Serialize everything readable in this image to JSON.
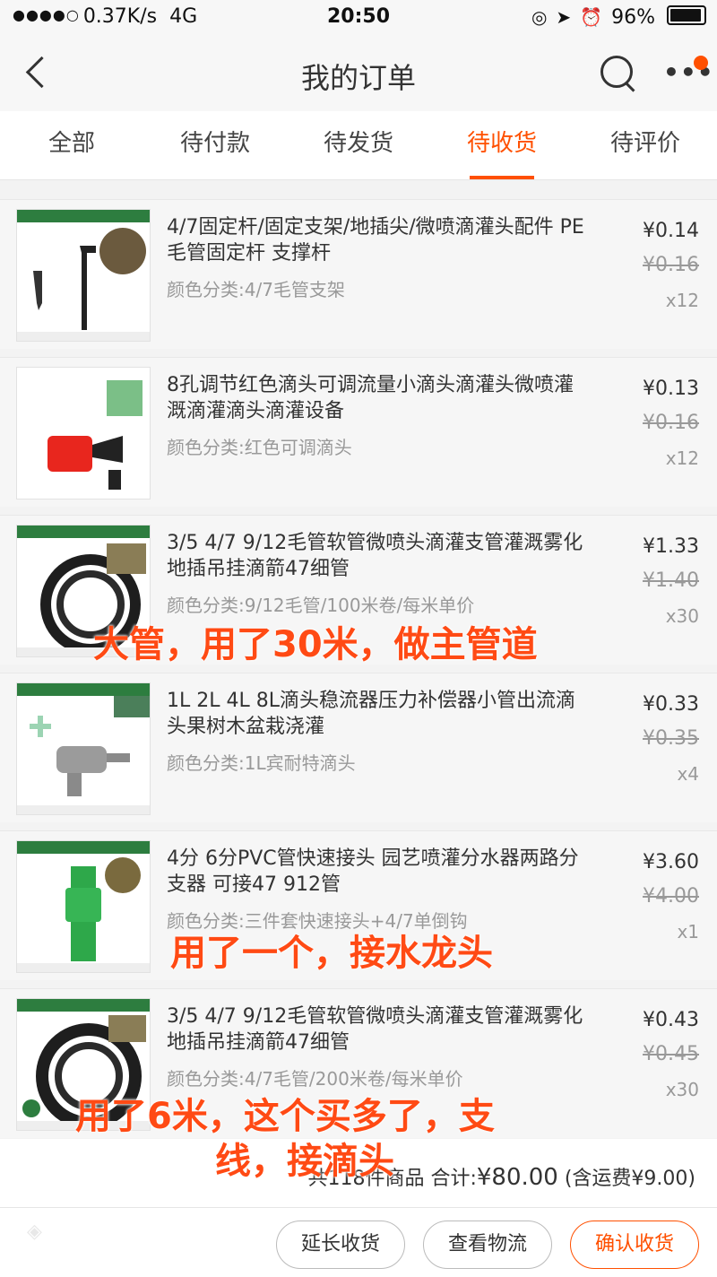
{
  "statusbar": {
    "signal": "●●●●○",
    "speed": "0.37K/s",
    "network": "4G",
    "time": "20:50",
    "battery": "96%"
  },
  "navbar": {
    "title": "我的订单"
  },
  "tabs": [
    {
      "label": "全部"
    },
    {
      "label": "待付款"
    },
    {
      "label": "待发货"
    },
    {
      "label": "待收货"
    },
    {
      "label": "待评价"
    }
  ],
  "active_tab": "待收货",
  "orders": [
    {
      "name": "4/7固定杆/固定支架/地插尖/微喷滴灌头配件 PE毛管固定杆 支撑杆",
      "sku": "颜色分类:4/7毛管支架",
      "price": "¥0.14",
      "original_price": "¥0.16",
      "qty": "x12"
    },
    {
      "name": "8孔调节红色滴头可调流量小滴头滴灌头微喷灌溉滴灌滴头滴灌设备",
      "sku": "颜色分类:红色可调滴头",
      "price": "¥0.13",
      "original_price": "¥0.16",
      "qty": "x12"
    },
    {
      "name": "3/5 4/7 9/12毛管软管微喷头滴灌支管灌溉雾化地插吊挂滴箭47细管",
      "sku": "颜色分类:9/12毛管/100米卷/每米单价",
      "price": "¥1.33",
      "original_price": "¥1.40",
      "qty": "x30"
    },
    {
      "name": "1L 2L 4L 8L滴头稳流器压力补偿器小管出流滴头果树木盆栽浇灌",
      "sku": "颜色分类:1L宾耐特滴头",
      "price": "¥0.33",
      "original_price": "¥0.35",
      "qty": "x4"
    },
    {
      "name": "4分 6分PVC管快速接头 园艺喷灌分水器两路分支器 可接47 912管",
      "sku": "颜色分类:三件套快速接头+4/7单倒钩",
      "price": "¥3.60",
      "original_price": "¥4.00",
      "qty": "x1"
    },
    {
      "name": "3/5 4/7 9/12毛管软管微喷头滴灌支管灌溉雾化地插吊挂滴箭47细管",
      "sku": "颜色分类:4/7毛管/200米卷/每米单价",
      "price": "¥0.43",
      "original_price": "¥0.45",
      "qty": "x30"
    }
  ],
  "annotations": {
    "a1": "大管，用了30米，做主管道",
    "a2": "用了一个，接水龙头",
    "a3_line1": "用了6米，这个买多了，支",
    "a3_line2": "线，接滴头"
  },
  "summary": {
    "count_text": "共118件商品 合计:",
    "total": "¥80.00",
    "shipping": "(含运费¥9.00)"
  },
  "buttons": {
    "extend": "延长收货",
    "logistics": "查看物流",
    "confirm": "确认收货"
  },
  "colors": {
    "accent": "#ff5000",
    "annotation": "#ff4a14"
  }
}
